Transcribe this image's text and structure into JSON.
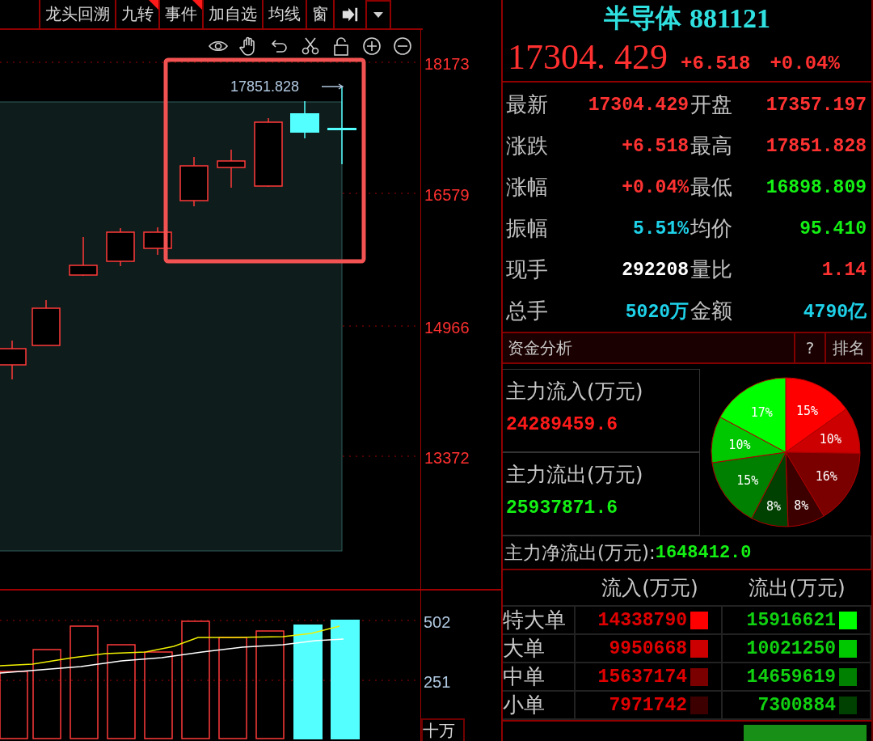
{
  "toolbar": {
    "tabs": [
      {
        "label": "龙头回溯",
        "flag": false
      },
      {
        "label": "九转",
        "flag": true
      },
      {
        "label": "事件",
        "flag": true
      },
      {
        "label": "加自选",
        "flag": false
      },
      {
        "label": "均线",
        "flag": false
      },
      {
        "label": "窗",
        "flag": false
      }
    ]
  },
  "chart": {
    "price_axis": [
      "18173",
      "16579",
      "14966",
      "13372"
    ],
    "high_marker": "17851.828",
    "highlight": true
  },
  "volume": {
    "axis": [
      "502",
      "251"
    ],
    "unit": "十万"
  },
  "quote": {
    "name": "半导体",
    "code": "881121",
    "price": "17304. 429",
    "change": "+6.518",
    "change_pct": "+0.04%"
  },
  "stats": [
    {
      "label": "最新",
      "value": "17304.429",
      "color": "#ff3232"
    },
    {
      "label": "开盘",
      "value": "17357.197",
      "color": "#ff3232"
    },
    {
      "label": "涨跌",
      "value": "+6.518",
      "color": "#ff3232"
    },
    {
      "label": "最高",
      "value": "17851.828",
      "color": "#ff3232"
    },
    {
      "label": "涨幅",
      "value": "+0.04%",
      "color": "#ff3232"
    },
    {
      "label": "最低",
      "value": "16898.809",
      "color": "#14f014"
    },
    {
      "label": "振幅",
      "value": "5.51%",
      "color": "#1ed2ea"
    },
    {
      "label": "均价",
      "value": "95.410",
      "color": "#14f014"
    },
    {
      "label": "现手",
      "value": "292208",
      "color": "#ffffff"
    },
    {
      "label": "量比",
      "value": "1.14",
      "color": "#ff3232"
    },
    {
      "label": "总手",
      "value": "5020万",
      "color": "#1ed2ea"
    },
    {
      "label": "金额",
      "value": "4790亿",
      "color": "#1ed2ea"
    }
  ],
  "fund": {
    "title": "资金分析",
    "help": "?",
    "rank": "排名",
    "inflow": {
      "label": "主力流入(万元)",
      "value": "24289459.6"
    },
    "outflow": {
      "label": "主力流出(万元)",
      "value": "25937871.6"
    },
    "chart_data": {
      "type": "pie",
      "values": [
        15,
        10,
        16,
        8,
        8,
        15,
        10,
        17
      ],
      "value_labels": [
        "15%",
        "10%",
        "16%",
        "8%",
        "8%",
        "15%",
        "10%",
        "17%"
      ]
    },
    "net": {
      "label": "主力净流出(万元):",
      "value": "1648412.0"
    },
    "columns": [
      "流入(万元)",
      "流出(万元)"
    ],
    "rows": [
      {
        "label": "特大单",
        "inflow": {
          "value": "14338790",
          "color": "#ff0000"
        },
        "outflow": {
          "value": "15916621",
          "color": "#00ff00"
        }
      },
      {
        "label": "大单",
        "inflow": {
          "value": "9950668",
          "color": "#cc0000"
        },
        "outflow": {
          "value": "10021250",
          "color": "#00c800"
        }
      },
      {
        "label": "中单",
        "inflow": {
          "value": "15637174",
          "color": "#7a0000"
        },
        "outflow": {
          "value": "14659619",
          "color": "#008000"
        }
      },
      {
        "label": "小单",
        "inflow": {
          "value": "7971742",
          "color": "#3c0000"
        },
        "outflow": {
          "value": "7300884",
          "color": "#004000"
        }
      }
    ]
  }
}
